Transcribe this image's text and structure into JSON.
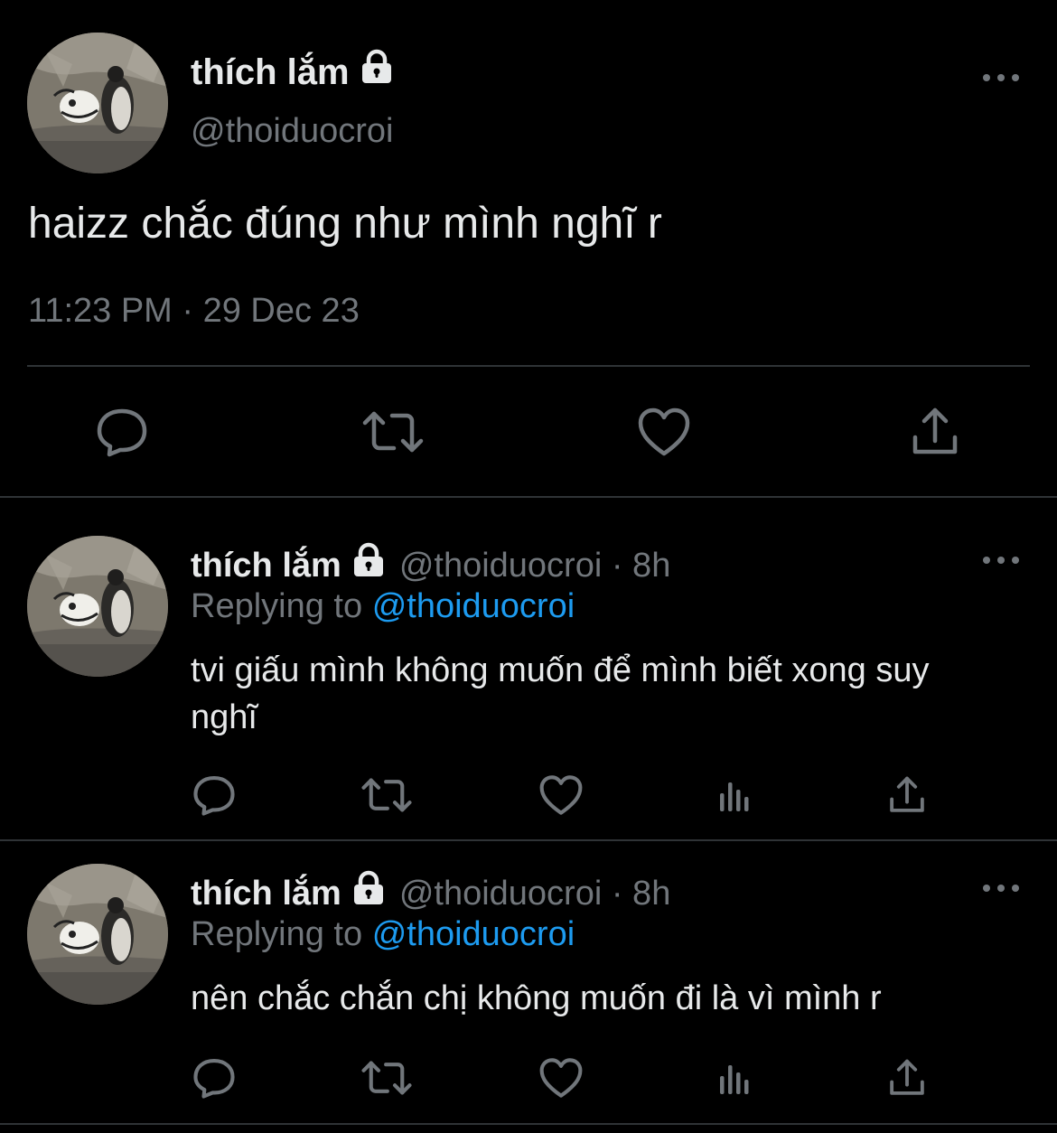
{
  "main_tweet": {
    "display_name": "thích lắm",
    "handle": "@thoiduocroi",
    "text": "haizz chắc đúng như mình nghĩ r",
    "timestamp": "11:23 PM · 29 Dec 23",
    "icons": [
      "lock-icon",
      "more-icon",
      "reply-icon",
      "retweet-icon",
      "like-icon",
      "share-icon"
    ]
  },
  "replies": [
    {
      "display_name": "thích lắm",
      "handle_time": "@thoiduocroi · 8h",
      "replying_prefix": "Replying to",
      "replying_handle": "@thoiduocroi",
      "text": "tvi giấu mình không muốn để mình biết xong suy nghĩ"
    },
    {
      "display_name": "thích lắm",
      "handle_time": "@thoiduocroi · 8h",
      "replying_prefix": "Replying to",
      "replying_handle": "@thoiduocroi",
      "text": "nên chắc chắn chị không muốn đi là vì mình r"
    }
  ],
  "colors": {
    "background": "#000000",
    "text": "#e7e9ea",
    "muted": "#71767b",
    "link": "#1d9bf0",
    "divider": "#2f3336"
  }
}
